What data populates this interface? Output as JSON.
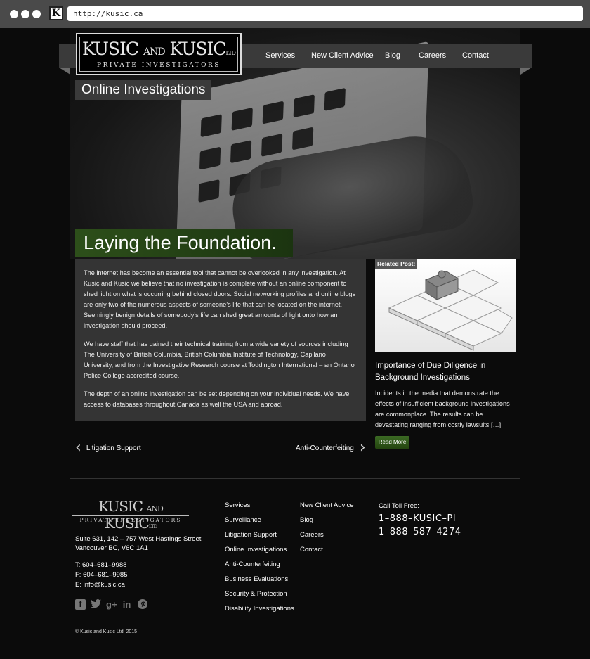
{
  "browser": {
    "url": "http://kusic.ca",
    "favicon_letter": "K"
  },
  "logo": {
    "main_left": "KUSIC",
    "main_and": "AND",
    "main_right": "KUSIC",
    "ltd": "LTD",
    "sub": "PRIVATE INVESTIGATORS"
  },
  "nav": [
    "Services",
    "New Client Advice",
    "Blog",
    "Careers",
    "Contact"
  ],
  "page": {
    "title": "Online Investigations",
    "headline": "Laying the Foundation.",
    "paragraphs": [
      "The internet has become an essential tool that cannot be overlooked in any investigation. At Kusic and Kusic we believe that no investigation is complete without an online component to shed light on what is occurring behind closed doors. Social networking profiles and online blogs are only two of the numerous aspects of someone’s life that can be located on the internet. Seemingly benign details of somebody’s life can shed great amounts of light onto how an investigation should proceed.",
      "We have staff that has gained their technical training from a wide variety of sources including The University of British Columbia, British Columbia Institute of Technology, Capilano University, and from the Investigative Research course at Toddington International – an Ontario Police College accredited course.",
      "The depth of an online investigation can be set depending on your individual needs. We have access to databases throughout Canada as well the USA and abroad."
    ]
  },
  "related": {
    "tag": "Related Post:",
    "title": "Importance of Due Diligence in Background Investigations",
    "excerpt": "Incidents in the media that demonstrate the effects of insufficient background investigations are commonplace. The results can be devastating ranging from costly lawsuits […]",
    "read_more": "Read More"
  },
  "pager": {
    "prev": "Litigation Support",
    "next": "Anti-Counterfeiting"
  },
  "footer": {
    "address_line1": "Suite 631, 142 – 757 West Hastings Street",
    "address_line2": "Vancouver BC, V6C 1A1",
    "tel": "T:  604–681–9988",
    "fax": "F:  604–681–9985",
    "email": "E:  info@kusic.ca",
    "col1": [
      "Services",
      "Surveillance",
      "Litigation Support",
      "Online Investigations",
      "Anti-Counterfeiting",
      "Business Evaluations",
      "Security & Protection",
      "Disability Investigations"
    ],
    "col2": [
      "New Client Advice",
      "Blog",
      "Careers",
      "Contact"
    ],
    "call_label": "Call Toll Free:",
    "phone1": "1–888–KUSIC–PI",
    "phone2": "1–888–587–4274",
    "copyright": "© Kusic and Kusic Ltd. 2015",
    "social_icons": [
      "facebook-icon",
      "twitter-icon",
      "google-plus-icon",
      "linkedin-icon",
      "pinterest-icon"
    ]
  },
  "colors": {
    "accent_green": "#2d4f1a",
    "background": "#0b0b0b",
    "panel": "#343434"
  }
}
